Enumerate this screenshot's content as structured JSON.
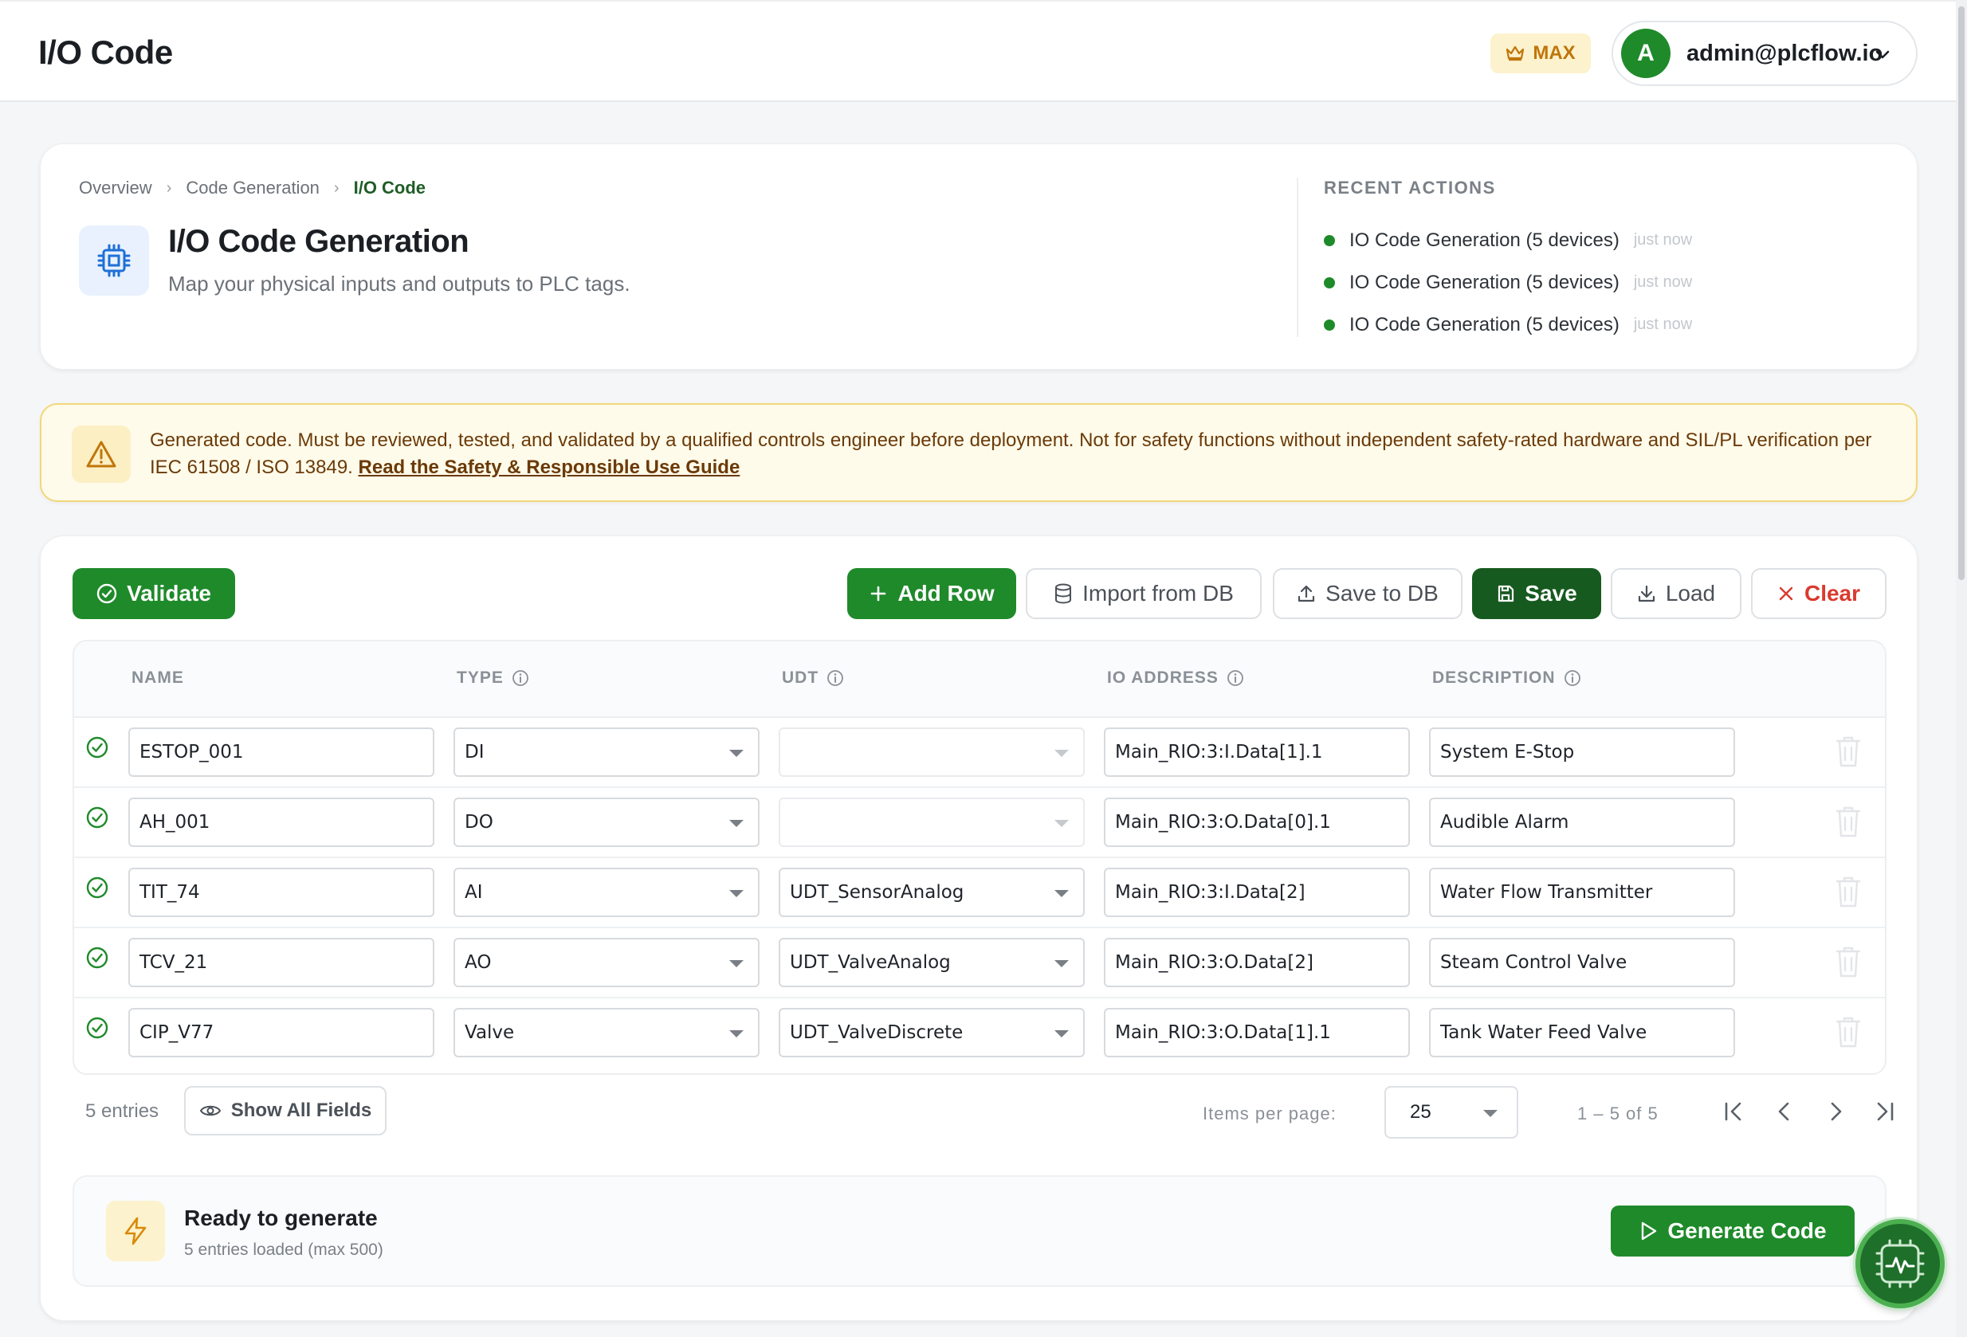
{
  "topbar": {
    "title": "I/O Code",
    "plan_badge": "MAX",
    "user_initial": "A",
    "user_email": "admin@plcflow.io"
  },
  "breadcrumb": [
    "Overview",
    "Code Generation",
    "I/O Code"
  ],
  "hero": {
    "title": "I/O Code Generation",
    "subtitle": "Map your physical inputs and outputs to PLC tags."
  },
  "recent_actions": {
    "title": "RECENT ACTIONS",
    "items": [
      {
        "label": "IO Code Generation (5 devices)",
        "when": "just now"
      },
      {
        "label": "IO Code Generation (5 devices)",
        "when": "just now"
      },
      {
        "label": "IO Code Generation (5 devices)",
        "when": "just now"
      }
    ]
  },
  "warning": {
    "text": "Generated code. Must be reviewed, tested, and validated by a qualified controls engineer before deployment. Not for safety functions without independent safety-rated hardware and SIL/PL verification per IEC 61508 / ISO 13849.",
    "link": "Read the Safety & Responsible Use Guide"
  },
  "toolbar": {
    "validate": "Validate",
    "add_row": "Add Row",
    "import_db": "Import from DB",
    "save_db": "Save to DB",
    "save": "Save",
    "load": "Load",
    "clear": "Clear"
  },
  "table": {
    "headers": {
      "name": "NAME",
      "type": "TYPE",
      "udt": "UDT",
      "io_address": "IO ADDRESS",
      "description": "DESCRIPTION"
    },
    "rows": [
      {
        "name": "ESTOP_001",
        "type": "DI",
        "udt": "",
        "io_address": "Main_RIO:3:I.Data[1].1",
        "description": "System E-Stop"
      },
      {
        "name": "AH_001",
        "type": "DO",
        "udt": "",
        "io_address": "Main_RIO:3:O.Data[0].1",
        "description": "Audible Alarm"
      },
      {
        "name": "TIT_74",
        "type": "AI",
        "udt": "UDT_SensorAnalog",
        "io_address": "Main_RIO:3:I.Data[2]",
        "description": "Water Flow Transmitter"
      },
      {
        "name": "TCV_21",
        "type": "AO",
        "udt": "UDT_ValveAnalog",
        "io_address": "Main_RIO:3:O.Data[2]",
        "description": "Steam Control Valve"
      },
      {
        "name": "CIP_V77",
        "type": "Valve",
        "udt": "UDT_ValveDiscrete",
        "io_address": "Main_RIO:3:O.Data[1].1",
        "description": "Tank Water Feed Valve"
      }
    ]
  },
  "footer": {
    "entries": "5 entries",
    "show_all": "Show All Fields",
    "items_per_page_label": "Items per page:",
    "items_per_page": "25",
    "range": "1 – 5 of 5"
  },
  "generate": {
    "title": "Ready to generate",
    "subtitle": "5 entries loaded (max 500)",
    "button": "Generate Code"
  },
  "colors": {
    "brand_green": "#1f8a2a",
    "dark_green": "#165a1f",
    "danger": "#d93a2f",
    "warning_bg": "#fffbea"
  }
}
